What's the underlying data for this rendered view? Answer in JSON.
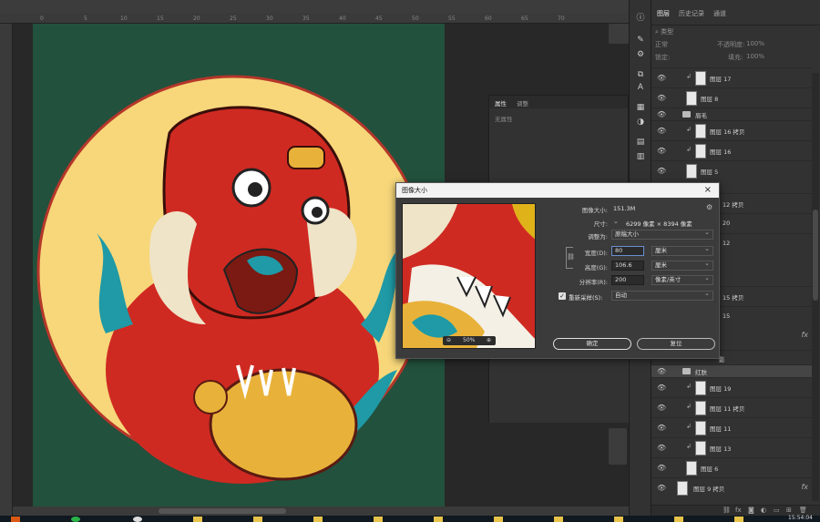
{
  "ruler": {
    "ticks": [
      "0",
      "5",
      "10",
      "15",
      "20",
      "25",
      "30",
      "35",
      "40",
      "45",
      "50",
      "55",
      "60",
      "65",
      "70"
    ]
  },
  "layers_panel": {
    "tabs": [
      "图层",
      "历史记录",
      "通道"
    ],
    "kind_label": "类型",
    "blend_mode": "正常",
    "opacity_label": "不透明度:",
    "opacity_value": "100%",
    "lock_label": "锁定:",
    "fill_label": "填充:",
    "fill_value": "100%",
    "items": [
      {
        "name": "图层 17",
        "type": "clip"
      },
      {
        "name": "图层 8",
        "type": "layer"
      },
      {
        "name": "眉毛",
        "type": "group"
      },
      {
        "name": "图层 16 拷贝",
        "type": "clip"
      },
      {
        "name": "图层 16",
        "type": "clip"
      },
      {
        "name": "图层 5",
        "type": "layer"
      },
      {
        "name": "12 拷贝",
        "type": "clip"
      },
      {
        "name": "20",
        "type": "clip"
      },
      {
        "name": "12",
        "type": "clip"
      },
      {
        "name": "",
        "type": "layer"
      },
      {
        "name": "15 拷贝",
        "type": "clip"
      },
      {
        "name": "15",
        "type": "clip"
      },
      {
        "name": "",
        "type": "layer"
      },
      {
        "name": "影",
        "type": "layer"
      },
      {
        "name": "红肤",
        "type": "group"
      },
      {
        "name": "图层 19",
        "type": "clip"
      },
      {
        "name": "图层 11 拷贝",
        "type": "clip"
      },
      {
        "name": "图层 11",
        "type": "clip"
      },
      {
        "name": "图层 13",
        "type": "clip"
      },
      {
        "name": "图层 6",
        "type": "layer"
      },
      {
        "name": "图层 9 拷贝",
        "type": "layer"
      }
    ]
  },
  "properties_panel": {
    "tabs": [
      "属性",
      "调整"
    ],
    "empty_text": "无属性"
  },
  "dialog": {
    "title": "图像大小",
    "zoom": "50%",
    "image_size_label": "图像大小:",
    "image_size_value": "151.3M",
    "dimensions_label": "尺寸:",
    "dimensions_value": "6299 像素  ×  8394 像素",
    "fit_label": "调整为:",
    "fit_value": "原稿大小",
    "width_label": "宽度(D):",
    "width_value": "80",
    "width_unit": "厘米",
    "height_label": "高度(G):",
    "height_value": "106.6",
    "height_unit": "厘米",
    "resolution_label": "分辨率(R):",
    "resolution_value": "200",
    "resolution_unit": "像素/英寸",
    "resample_label": "重新采样(S):",
    "resample_value": "自动",
    "ok_label": "确定",
    "reset_label": "复位"
  },
  "taskbar": {
    "clock": "15:54:04"
  },
  "colors": {
    "artboard": "#22513d",
    "sun": "#f7d77a",
    "lion_red": "#cf2a22",
    "teal": "#1f9aa6",
    "gold": "#e8b23a"
  }
}
